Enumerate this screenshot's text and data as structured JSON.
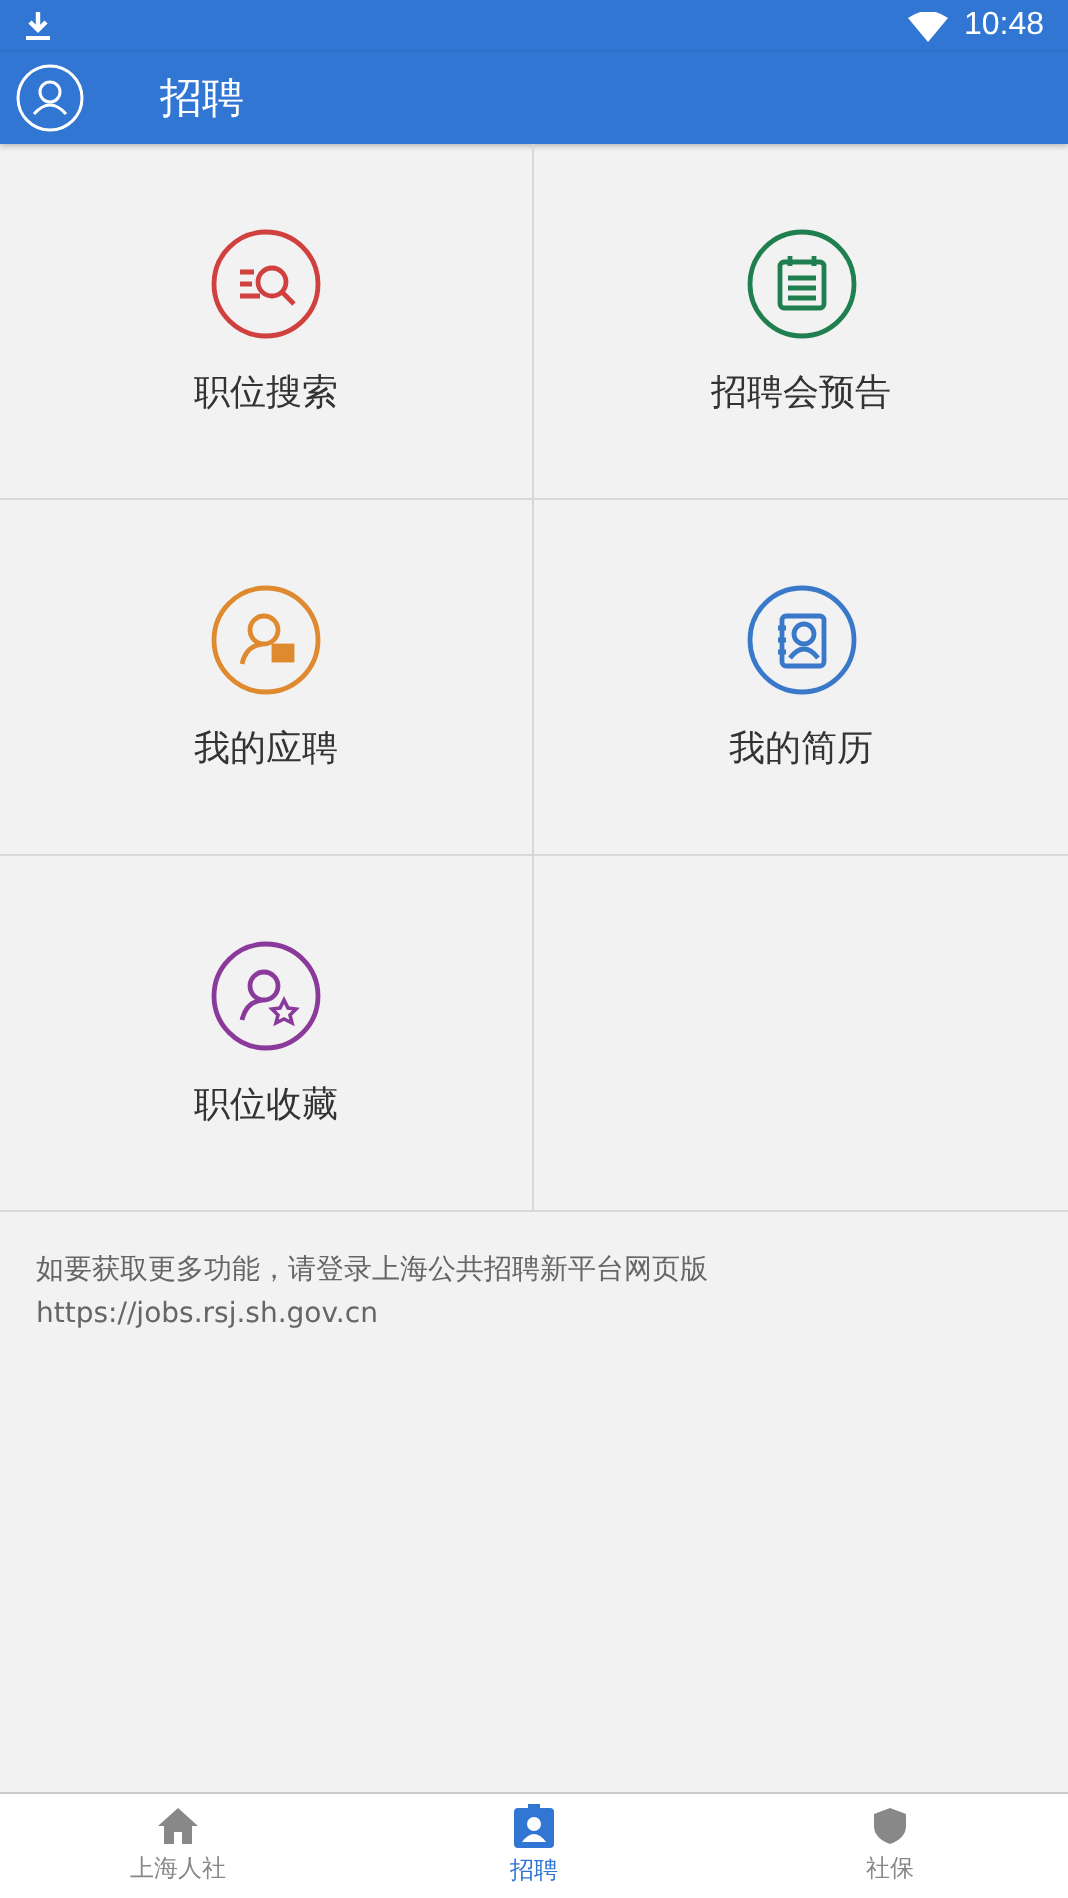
{
  "status_bar": {
    "time": "10:48"
  },
  "header": {
    "title": "招聘"
  },
  "tiles": [
    {
      "label": "职位搜索",
      "kind": "search",
      "color": "#d0403f"
    },
    {
      "label": "招聘会预告",
      "kind": "calendar",
      "color": "#1f7f4f"
    },
    {
      "label": "我的应聘",
      "kind": "applicant",
      "color": "#e08a30"
    },
    {
      "label": "我的简历",
      "kind": "resume",
      "color": "#3a78c9"
    },
    {
      "label": "职位收藏",
      "kind": "favorite",
      "color": "#8a3a9a"
    }
  ],
  "notice": {
    "text": "如要获取更多功能，请登录上海公共招聘新平台网页版",
    "url": "https://jobs.rsj.sh.gov.cn"
  },
  "tabs": [
    {
      "label": "上海人社",
      "kind": "home",
      "selected": false
    },
    {
      "label": "招聘",
      "kind": "badge",
      "selected": true
    },
    {
      "label": "社保",
      "kind": "shield",
      "selected": false
    }
  ]
}
